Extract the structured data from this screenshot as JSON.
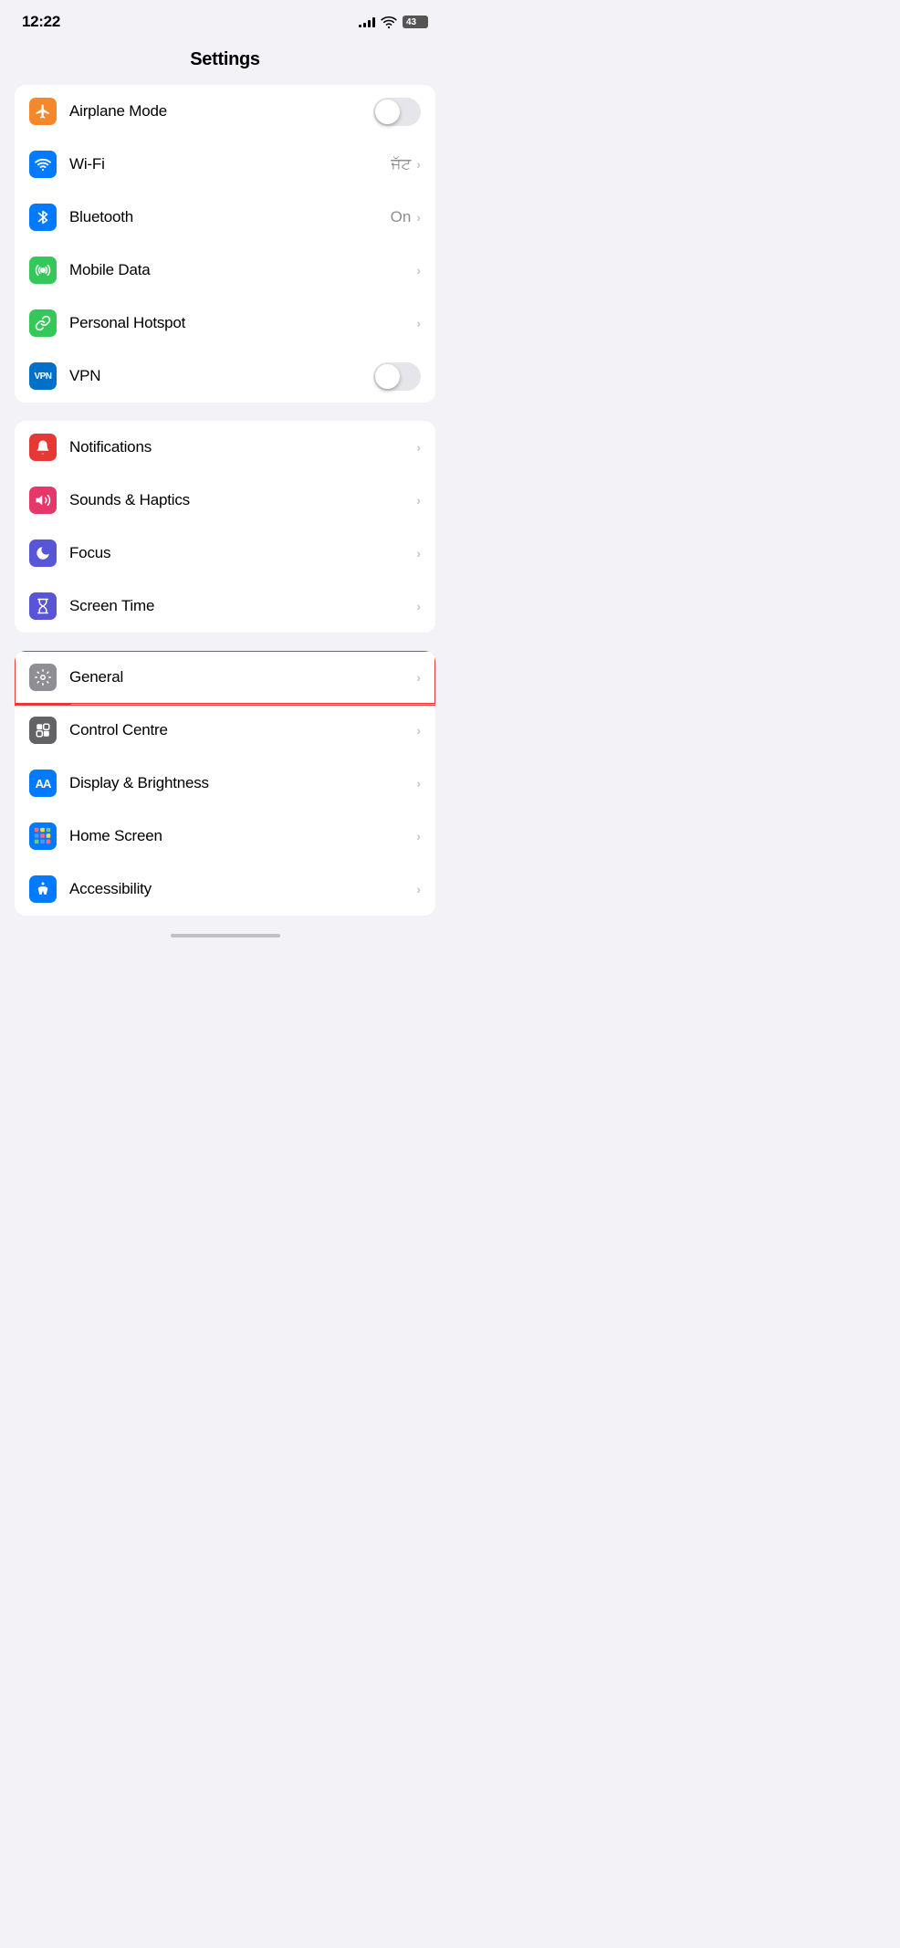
{
  "statusBar": {
    "time": "12:22",
    "battery": "43"
  },
  "header": {
    "title": "Settings"
  },
  "sections": [
    {
      "id": "connectivity",
      "rows": [
        {
          "id": "airplane-mode",
          "label": "Airplane Mode",
          "iconBg": "icon-orange",
          "iconType": "airplane",
          "control": "toggle",
          "toggleOn": false
        },
        {
          "id": "wifi",
          "label": "Wi-Fi",
          "iconBg": "icon-blue",
          "iconType": "wifi",
          "control": "chevron",
          "value": "ਜੱਟ"
        },
        {
          "id": "bluetooth",
          "label": "Bluetooth",
          "iconBg": "icon-blue",
          "iconType": "bluetooth",
          "control": "chevron",
          "value": "On"
        },
        {
          "id": "mobile-data",
          "label": "Mobile Data",
          "iconBg": "icon-green",
          "iconType": "mobile-data",
          "control": "chevron",
          "value": ""
        },
        {
          "id": "personal-hotspot",
          "label": "Personal Hotspot",
          "iconBg": "icon-green",
          "iconType": "hotspot",
          "control": "chevron",
          "value": ""
        },
        {
          "id": "vpn",
          "label": "VPN",
          "iconBg": "icon-vpn-blue",
          "iconType": "vpn",
          "control": "toggle",
          "toggleOn": false
        }
      ]
    },
    {
      "id": "system1",
      "rows": [
        {
          "id": "notifications",
          "label": "Notifications",
          "iconBg": "icon-red-dark",
          "iconType": "notifications",
          "control": "chevron",
          "value": ""
        },
        {
          "id": "sounds-haptics",
          "label": "Sounds & Haptics",
          "iconBg": "icon-pink",
          "iconType": "sounds",
          "control": "chevron",
          "value": ""
        },
        {
          "id": "focus",
          "label": "Focus",
          "iconBg": "icon-purple",
          "iconType": "focus",
          "control": "chevron",
          "value": ""
        },
        {
          "id": "screen-time",
          "label": "Screen Time",
          "iconBg": "icon-purple-dark",
          "iconType": "screen-time",
          "control": "chevron",
          "value": ""
        }
      ]
    },
    {
      "id": "system2",
      "rows": [
        {
          "id": "general",
          "label": "General",
          "iconBg": "icon-gray",
          "iconType": "general",
          "control": "chevron",
          "value": "",
          "highlighted": true
        },
        {
          "id": "control-centre",
          "label": "Control Centre",
          "iconBg": "icon-toggle-gray",
          "iconType": "control-centre",
          "control": "chevron",
          "value": ""
        },
        {
          "id": "display-brightness",
          "label": "Display & Brightness",
          "iconBg": "icon-aa-blue",
          "iconType": "display",
          "control": "chevron",
          "value": ""
        },
        {
          "id": "home-screen",
          "label": "Home Screen",
          "iconBg": "icon-multicolor",
          "iconType": "home-screen",
          "control": "chevron",
          "value": ""
        },
        {
          "id": "accessibility",
          "label": "Accessibility",
          "iconBg": "icon-accessibility",
          "iconType": "accessibility",
          "control": "chevron",
          "value": ""
        }
      ]
    }
  ]
}
